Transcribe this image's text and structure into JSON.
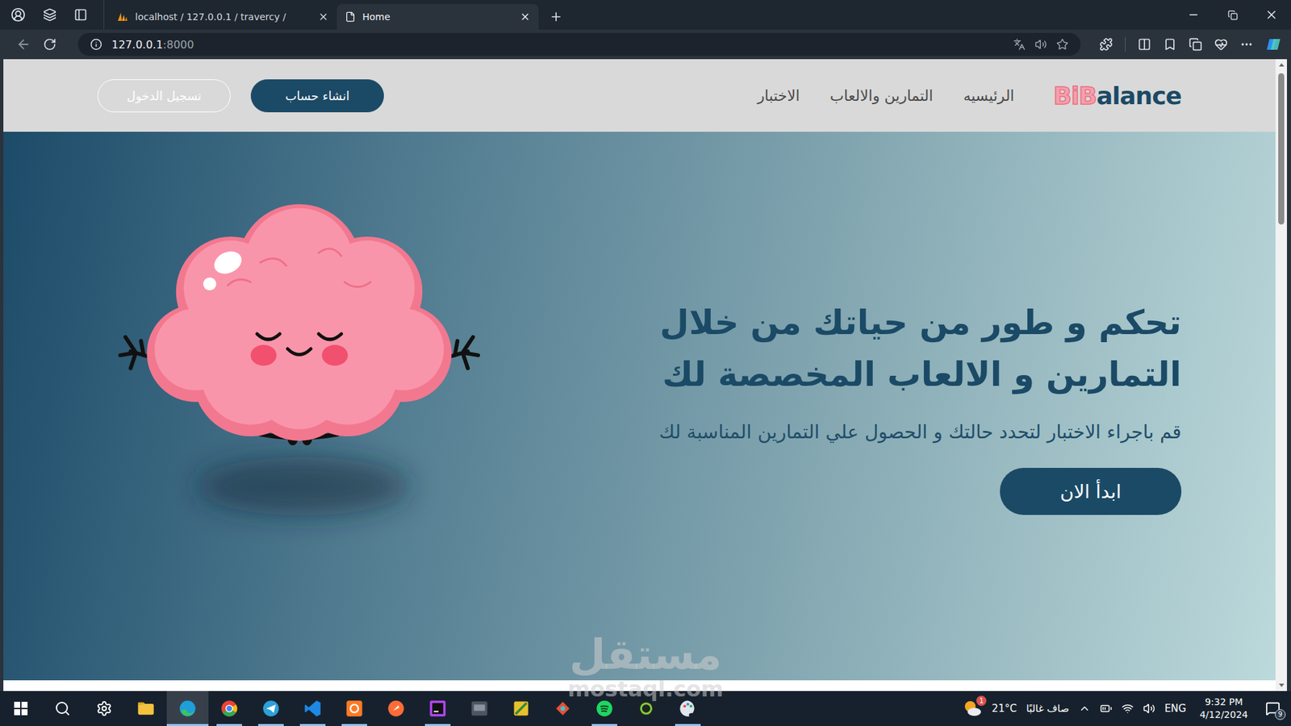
{
  "browser": {
    "tabs": [
      {
        "label": "localhost / 127.0.0.1 / travercy /",
        "selected": false
      },
      {
        "label": "Home",
        "selected": true
      }
    ],
    "address_bar": {
      "host": "127.0.0.1",
      "port": ":8000"
    }
  },
  "page": {
    "logo": {
      "accent": "BiB",
      "rest": "alance"
    },
    "nav": [
      {
        "label": "الرئيسيه"
      },
      {
        "label": "التمارين والالعاب"
      },
      {
        "label": "الاختبار"
      }
    ],
    "buttons": {
      "signup": "انشاء حساب",
      "login": "تسجيل الدخول"
    },
    "hero": {
      "title": "تحكم و طور من حياتك من خلال التمارين و الالعاب المخصصة لك",
      "subtitle": "قم باجراء الاختبار لتحدد حالتك و الحصول علي التمارين المناسبة لك",
      "cta": "ابدأ الان"
    }
  },
  "watermark": {
    "name": "مستقل",
    "domain": "mostaql.com"
  },
  "taskbar": {
    "apps": [
      {
        "running": false,
        "selected": false
      },
      {
        "running": true,
        "selected": true
      },
      {
        "running": true,
        "selected": false
      },
      {
        "running": true,
        "selected": false
      },
      {
        "running": true,
        "selected": false
      },
      {
        "running": true,
        "selected": false
      },
      {
        "running": false,
        "selected": false
      },
      {
        "running": true,
        "selected": false
      },
      {
        "running": false,
        "selected": false
      },
      {
        "running": false,
        "selected": false
      },
      {
        "running": false,
        "selected": false
      },
      {
        "running": true,
        "selected": false
      },
      {
        "running": false,
        "selected": false
      },
      {
        "running": true,
        "selected": false
      }
    ],
    "weather": {
      "temp": "21°C",
      "condition": "صاف غالبًا",
      "badge": "1"
    },
    "language": "ENG",
    "time": "9:32 PM",
    "date": "4/12/2024",
    "notifications": "9"
  }
}
